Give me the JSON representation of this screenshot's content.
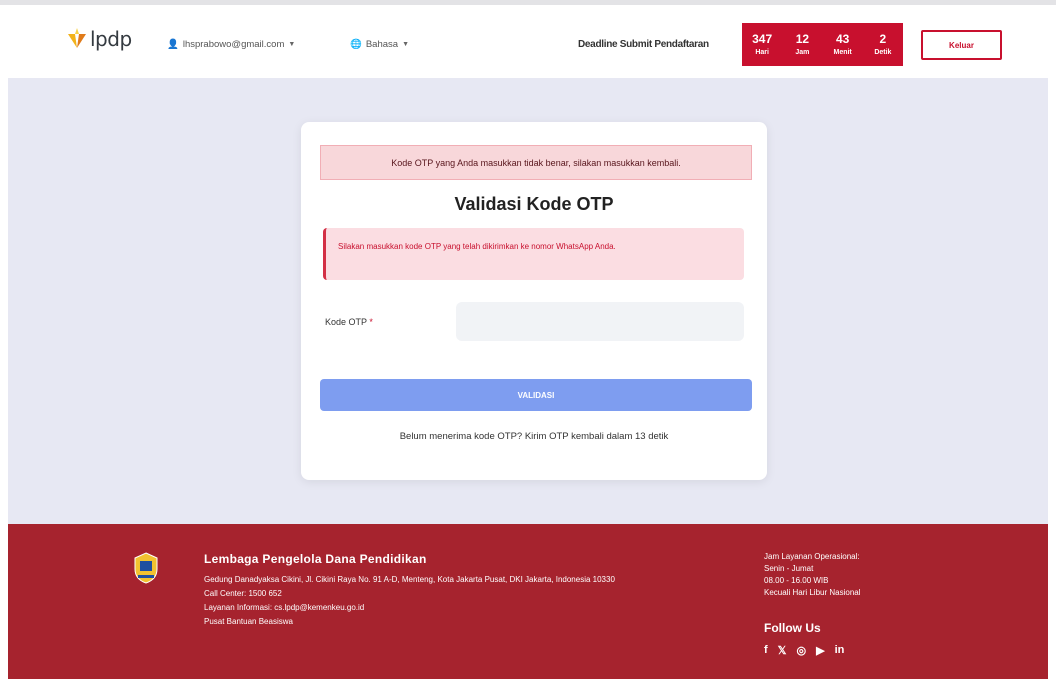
{
  "header": {
    "logo_text": "lpdp",
    "user_email": "lhsprabowo@gmail.com",
    "language": "Bahasa",
    "deadline_label": "Deadline Submit Pendaftaran",
    "countdown": [
      {
        "value": "347",
        "unit": "Hari"
      },
      {
        "value": "12",
        "unit": "Jam"
      },
      {
        "value": "43",
        "unit": "Menit"
      },
      {
        "value": "2",
        "unit": "Detik"
      }
    ],
    "logout_label": "Keluar"
  },
  "card": {
    "alert_top": "Kode OTP yang Anda masukkan tidak benar, silakan masukkan kembali.",
    "title": "Validasi Kode OTP",
    "alert_info": "Silakan masukkan kode OTP yang telah dikirimkan ke nomor WhatsApp Anda.",
    "otp_label": "Kode OTP",
    "otp_required": "*",
    "otp_value": "",
    "submit_label": "VALIDASI",
    "resend_text": "Belum menerima kode OTP? Kirim OTP kembali dalam 13 detik"
  },
  "footer": {
    "org_name": "Lembaga Pengelola Dana Pendidikan",
    "address": "Gedung Danadyaksa Cikini, Jl. Cikini Raya No. 91 A-D, Menteng, Kota Jakarta Pusat, DKI Jakarta, Indonesia 10330",
    "phone": "Call Center: 1500 652",
    "email": "Layanan Informasi: cs.lpdp@kemenkeu.go.id",
    "help": "Pusat Bantuan Beasiswa",
    "right_lines": [
      "Jam Layanan Operasional:",
      "Senin - Jumat",
      "08.00 - 16.00 WIB",
      "Kecuali Hari Libur Nasional"
    ],
    "follow_title": "Follow Us",
    "socials": [
      {
        "icon": "facebook-icon",
        "glyph": "f"
      },
      {
        "icon": "twitter-icon",
        "glyph": "𝕏"
      },
      {
        "icon": "instagram-icon",
        "glyph": "◎"
      },
      {
        "icon": "youtube-icon",
        "glyph": "▶"
      },
      {
        "icon": "linkedin-icon",
        "glyph": "in"
      }
    ]
  },
  "colors": {
    "brand_red": "#c8102e",
    "footer_red": "#a6232e",
    "button_blue": "#7e9df0",
    "page_bg": "#e7e8f3"
  }
}
